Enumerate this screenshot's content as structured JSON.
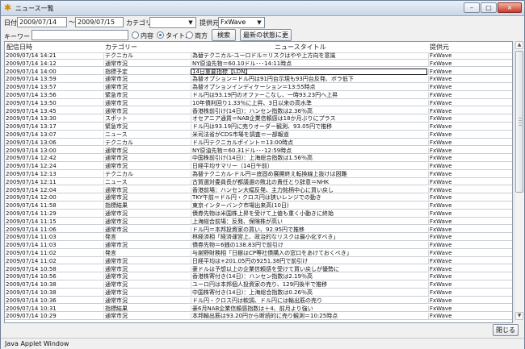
{
  "window": {
    "title": "ニュース一覧",
    "title_icon": "news-icon",
    "close_label": "×",
    "minimize_label": "–",
    "maximize_label": "□"
  },
  "filters": {
    "date_label": "日付",
    "date_from": "2009/07/14",
    "tilde": "～",
    "date_to": "2009/07/15",
    "category_label": "カテゴリー",
    "category_value": "",
    "provider_label": "提供元",
    "provider_value": "FxWave",
    "keyword_label": "キーワード",
    "keyword_value": "",
    "radio_content": "内容",
    "radio_title": "タイトル",
    "radio_both": "両方",
    "search_button": "検索",
    "refresh_button": "最新の状態に更新"
  },
  "table": {
    "headers": [
      "配信日時",
      "カテゴリー",
      "ニュースタイトル",
      "提供元"
    ],
    "rows": [
      [
        "2009/07/14 14:21",
        "テクニカル",
        "為替テクニカル-ユーロドル＝リスクはやや上方向を意識",
        "FxWave"
      ],
      [
        "2009/07/14 14:12",
        "通常市況",
        "NY原油先物＝60.10ドル･･･14:11時点",
        "FxWave"
      ],
      [
        "2009/07/14 14:00",
        "指標予定",
        "14日重要指標【LDN】",
        "FxWave"
      ],
      [
        "2009/07/14 13:59",
        "通常市況",
        "為替オプション＝ドル円は91円台示現も93円台反発、ボラ低下",
        "FxWave"
      ],
      [
        "2009/07/14 13:57",
        "通常市況",
        "為替オプションインディケーション＝13:55時点",
        "FxWave"
      ],
      [
        "2009/07/14 13:56",
        "緊急市況",
        "ドル円は93.19円のオファーこなし、一時93.23円へ上昇",
        "FxWave"
      ],
      [
        "2009/07/14 13:50",
        "通常市況",
        "10年債利回り1.33％に上昇、3日以来の高水準",
        "FxWave"
      ],
      [
        "2009/07/14 13:45",
        "通常市況",
        "香港株前引け(14日)：ハンセン指数は2.36％高",
        "FxWave"
      ],
      [
        "2009/07/14 13:30",
        "スポット",
        "オセアニア通貨＝NAB企業信頼感は18か月ぶりにプラス",
        "FxWave"
      ],
      [
        "2009/07/14 13:17",
        "緊急市況",
        "ドル円は93.19円に売りオーダー観測、93.05円で推移",
        "FxWave"
      ],
      [
        "2009/07/14 13:07",
        "ニュース",
        "米司法省がCDS市場を調査＝一部報道",
        "FxWave"
      ],
      [
        "2009/07/14 13:06",
        "テクニカル",
        "ドル円テクニカルポイント＝13:00時点",
        "FxWave"
      ],
      [
        "2009/07/14 13:00",
        "通常市況",
        "NY原油先物＝60.31ドル･･･12:59時点",
        "FxWave"
      ],
      [
        "2009/07/14 12:42",
        "通常市況",
        "中国株前引け(14日)：上海総合指数は1.56％高",
        "FxWave"
      ],
      [
        "2009/07/14 12:24",
        "通常市況",
        "日経平均サマリー（14日午前）",
        "FxWave"
      ],
      [
        "2009/07/14 12:13",
        "テクニカル",
        "為替テクニカル-ドル円＝底固め展開終え転換線上抜けは困難",
        "FxWave"
      ],
      [
        "2009/07/14 12:11",
        "ニュース",
        "古賀選対委員長が都議選の敗北の責任とり辞意＝NHK",
        "FxWave"
      ],
      [
        "2009/07/14 12:04",
        "通常市況",
        "香港前場：ハンセン大幅反発、主力銘柄中心に買い戻し",
        "FxWave"
      ],
      [
        "2009/07/14 12:00",
        "通常市況",
        "TKY午前＝ドル円・クロス円は狭いレンジでの動き",
        "FxWave"
      ],
      [
        "2009/07/14 11:58",
        "指標結果",
        "東京インターバンク市場出来高(10日)",
        "FxWave"
      ],
      [
        "2009/07/14 11:29",
        "通常市況",
        "債券先物は米国株上昇を受けて上値も重く小動きに終始",
        "FxWave"
      ],
      [
        "2009/07/14 11:15",
        "通常市況",
        "上海総合前場：反発、保険株が高い",
        "FxWave"
      ],
      [
        "2009/07/14 11:06",
        "通常市況",
        "ドル円＝本邦投資家の買い、92.95円で推移",
        "FxWave"
      ],
      [
        "2009/07/14 11:03",
        "発言",
        "林経済相「経済運営上、政治的なリスクは最小化すべき」",
        "FxWave"
      ],
      [
        "2009/07/14 11:03",
        "通常市況",
        "債券先物＝6銭の138.83円で前引け",
        "FxWave"
      ],
      [
        "2009/07/14 11:02",
        "発言",
        "与謝野財務相「日銀はCP等社債購入の窓口をあけておくべき」",
        "FxWave"
      ],
      [
        "2009/07/14 11:02",
        "通常市況",
        "日経平均は+201.05円の9251.38円で前引け",
        "FxWave"
      ],
      [
        "2009/07/14 10:58",
        "通常市況",
        "豪ドルは予想以上の企業信頼感を受けて買い戻しが優勢に",
        "FxWave"
      ],
      [
        "2009/07/14 10:56",
        "通常市況",
        "香港株寄付き(14日)：ハンセン指数は2.19％高",
        "FxWave"
      ],
      [
        "2009/07/14 10:38",
        "通常市況",
        "ユーロ円は本邦個人投資家の売り、129円後半で推移",
        "FxWave"
      ],
      [
        "2009/07/14 10:38",
        "通常市況",
        "中国株寄付き(14日)：上海総合指数は0.26％高",
        "FxWave"
      ],
      [
        "2009/07/14 10:36",
        "通常市況",
        "ドル円・クロス円は軟調、ドル円には輸出筋の売り",
        "FxWave"
      ],
      [
        "2009/07/14 10:31",
        "指標結果",
        "豪6月NAB企業信頼感指数は＋4、前月より強い",
        "FxWave"
      ],
      [
        "2009/07/14 10:29",
        "通常市況",
        "本邦輸出筋は93.20円から断続的に売り観測＝10:25時点",
        "FxWave"
      ]
    ]
  },
  "footer": {
    "close_button": "閉じる",
    "status_text": "Java Applet Window"
  }
}
